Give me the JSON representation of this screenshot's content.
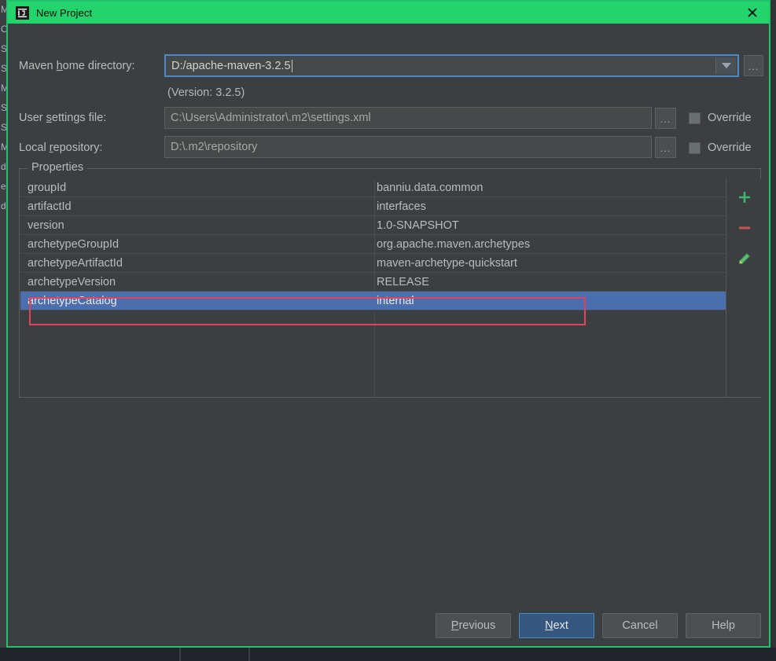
{
  "window": {
    "title": "New Project",
    "logo_icon": "intellij-idea-logo",
    "close_icon": "close-icon",
    "titlebar_color": "#22d46b",
    "border_color": "#23c16b"
  },
  "form": {
    "maven_home": {
      "label_pre": "Maven ",
      "label_mnemonic": "h",
      "label_post": "ome directory:",
      "value": "D:/apache-maven-3.2.5",
      "dropdown_icon": "chevron-down-icon",
      "browse_label": "...",
      "version_hint": "(Version: 3.2.5)"
    },
    "user_settings": {
      "label_pre": "User ",
      "label_mnemonic": "s",
      "label_post": "ettings file:",
      "value": "C:\\Users\\Administrator\\.m2\\settings.xml",
      "browse_label": "...",
      "override_label": "Override",
      "override_checked": false
    },
    "local_repository": {
      "label_pre": "Local ",
      "label_mnemonic": "r",
      "label_post": "epository:",
      "value": "D:\\.m2\\repository",
      "browse_label": "...",
      "override_label": "Override",
      "override_checked": false
    }
  },
  "properties": {
    "title": "Properties",
    "rows": [
      {
        "key": "groupId",
        "value": "banniu.data.common"
      },
      {
        "key": "artifactId",
        "value": "interfaces"
      },
      {
        "key": "version",
        "value": "1.0-SNAPSHOT"
      },
      {
        "key": "archetypeGroupId",
        "value": "org.apache.maven.archetypes"
      },
      {
        "key": "archetypeArtifactId",
        "value": "maven-archetype-quickstart"
      },
      {
        "key": "archetypeVersion",
        "value": "RELEASE"
      },
      {
        "key": "archetypeCatalog",
        "value": "internal"
      }
    ],
    "selected_row_index": 6,
    "selection_color": "#4b6eaf",
    "toolbar": [
      {
        "name": "add-property-button",
        "icon": "plus-icon",
        "color": "#3cb46e"
      },
      {
        "name": "remove-property-button",
        "icon": "minus-icon",
        "color": "#c75450"
      },
      {
        "name": "edit-property-button",
        "icon": "pencil-icon",
        "color": "#4aa563"
      }
    ],
    "annotation": {
      "type": "highlight-rectangle",
      "color": "#e0435a",
      "target_row": "archetypeCatalog"
    }
  },
  "footer": {
    "buttons": [
      {
        "name": "previous-button",
        "pre": "",
        "mnemonic": "P",
        "post": "revious",
        "default": false
      },
      {
        "name": "next-button",
        "pre": "",
        "mnemonic": "N",
        "post": "ext",
        "default": true
      },
      {
        "name": "cancel-button",
        "pre": "C",
        "mnemonic": "",
        "post": "ancel",
        "default": false
      },
      {
        "name": "help-button",
        "pre": "H",
        "mnemonic": "",
        "post": "elp",
        "default": false
      }
    ]
  },
  "background": {
    "left_gutter_chars": "M\nO\nS\nS\nM\nS\nS\nM\nd\ne\nd\n",
    "editor_color": "#313335"
  }
}
